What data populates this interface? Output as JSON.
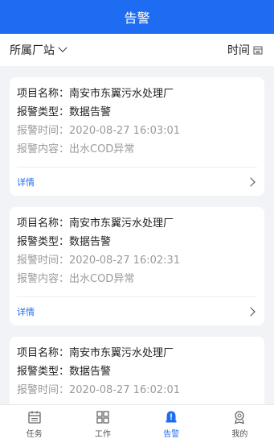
{
  "header": {
    "title": "告警"
  },
  "filter": {
    "station_label": "所属厂站",
    "time_label": "时间"
  },
  "cards": [
    {
      "project": "项目名称：南安市东翼污水处理厂",
      "type": "报警类型：数据告警",
      "time": "报警时间：2020-08-27 16:03:01",
      "content": "报警内容：出水COD异常",
      "detail": "详情"
    },
    {
      "project": "项目名称：南安市东翼污水处理厂",
      "type": "报警类型：数据告警",
      "time": "报警时间：2020-08-27 16:02:31",
      "content": "报警内容：出水COD异常",
      "detail": "详情"
    },
    {
      "project": "项目名称：南安市东翼污水处理厂",
      "type": "报警类型：数据告警",
      "time": "报警时间：2020-08-27 16:02:01",
      "content": "",
      "detail": ""
    }
  ],
  "tabs": [
    {
      "label": "任务",
      "icon": "task-icon"
    },
    {
      "label": "工作",
      "icon": "work-icon"
    },
    {
      "label": "告警",
      "icon": "alarm-icon",
      "active": true
    },
    {
      "label": "我的",
      "icon": "profile-icon"
    }
  ],
  "colors": {
    "accent": "#1e6cf2",
    "background": "#f2f3f7"
  }
}
